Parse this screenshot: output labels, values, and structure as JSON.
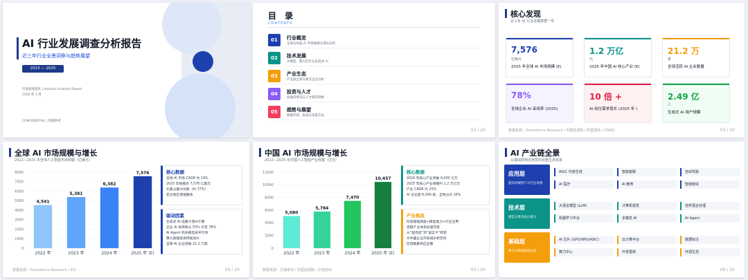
{
  "slide1": {
    "title": "AI 行业发展调查分析报告",
    "subtitle": "近三年行业全景洞察与趋势展望",
    "years": "2023 — 2025",
    "org": "行业研究团队 | Industry Analysis Report",
    "date": "2026 年 1 月",
    "confidential": "CONFIDENTIAL | 内部参考",
    "colors": {
      "accent": "#1e3a8a",
      "circle_dark": "#1e40af",
      "circle_light": "#dbe6f9"
    }
  },
  "slide2": {
    "title": "目 录",
    "title_en": "CONTENTS",
    "page": "02 / 20",
    "items": [
      {
        "num": "01",
        "label": "行业概览",
        "desc": "全球与中国 AI 市场规模与增长态势",
        "color": "#1e40af"
      },
      {
        "num": "02",
        "label": "技术发展",
        "desc": "大模型、算力芯片与生成式 AI",
        "color": "#0d9488"
      },
      {
        "num": "03",
        "label": "产业生态",
        "desc": "产业链全景与重点企业分析",
        "color": "#f59e0b"
      },
      {
        "num": "04",
        "label": "投资与人才",
        "desc": "投融资情况与人才需求洞察",
        "color": "#8b5cf6"
      },
      {
        "num": "05",
        "label": "趋势与展望",
        "desc": "政策环境、挑战与未来方向",
        "color": "#f43f5e"
      }
    ]
  },
  "slide3": {
    "title": "核心发现",
    "subtitle": "近三年 AI 行业关键数据一览",
    "source": "数据来源：Precedence Research / 中国信通院 / 阿里通信 / CNNIC",
    "page": "03 / 20",
    "cards": [
      {
        "value": "7,576",
        "unit": "亿美元",
        "desc": "2025 年全球 AI 市场规模 (E)",
        "color": "#1e40af",
        "bg": "#ffffff"
      },
      {
        "value": "1.2 万亿",
        "unit": "元",
        "desc": "2025 年中国 AI 核心产业 (E)",
        "color": "#0d9488",
        "bg": "#ffffff"
      },
      {
        "value": "21.2 万",
        "unit": "家",
        "desc": "全球活跃 AI 企业数量",
        "color": "#f59e0b",
        "bg": "#ffffff"
      },
      {
        "value": "78%",
        "unit": "",
        "desc": "全球企业 AI 采用率 (2025)",
        "color": "#8b5cf6",
        "bg": "#f5f3ff"
      },
      {
        "value": "10 倍 +",
        "unit": "",
        "desc": "AI 岗位需求增长 (2025 年 )",
        "color": "#e11d48",
        "bg": "#fff1f2"
      },
      {
        "value": "2.49 亿",
        "unit": "人",
        "desc": "生成式 AI 用户规模",
        "color": "#16a34a",
        "bg": "#f0fdf4"
      }
    ]
  },
  "slide4": {
    "title": "全球 AI 市场规模与增长",
    "subtitle": "2022—2025 年全球人工智能市场规模（亿美元）",
    "source": "数据来源：Precedence Research / IDC",
    "page": "04 / 20",
    "box1": {
      "heading": "核心数据",
      "lines": [
        "全球 AI 市场 CAGR 约 19%",
        "2025 年规模达 7,576 亿美元",
        "北美占最大份额（约 37%）",
        "亚太地区增速最快"
      ]
    },
    "box2": {
      "heading": "驱动因素",
      "lines": [
        "生成式 AI 成最大增长引擎",
        "企业 AI 采用率从 55% 升至 78%",
        "AI Agent 和多模态技术引领",
        "算力基建投资持续加大",
        "全球 AI 企业突破 21.2 万家"
      ]
    }
  },
  "slide5": {
    "title": "中国 AI 市场规模与增长",
    "subtitle": "2022—2025 年中国人工智能产业规模（亿元）",
    "source": "数据来源：艾瑞咨询 / 中国信通院 / 艾瑞咨询",
    "page": "05 / 20",
    "box1": {
      "heading": "核心数据",
      "lines": [
        "2024 年核心产业突破 9,000 亿元",
        "2025 年核心产业规模约 1.2 万亿元",
        "产业 CAGR 约 25%",
        "AI 企业超 6,000 家，全球占比 16%"
      ]
    },
    "box2": {
      "heading": "产业格局",
      "lines": [
        "形成基础底座+模型能力+行业应用",
        "百模产业体系加速完善",
        "从“能完成”到“能实干”转变",
        "为中国企业开拓城乡新空间",
        "区域集聚效应显著"
      ]
    }
  },
  "slide6": {
    "title": "AI 产业链全景",
    "subtitle": "从基础层到应用层的完整生态体系",
    "page": "06 / 20",
    "layers": [
      {
        "name": "应用层",
        "desc": "面向终端用户与行业场景",
        "color": "#1e40af",
        "cells": [
          "AIGC 内容生成",
          "智能客服",
          "自动驾驶",
          "AI 医疗",
          "AI 教育",
          "智能制造"
        ]
      },
      {
        "name": "技术层",
        "desc": "模型与算法核心能力",
        "color": "#0d9488",
        "cells": [
          "大语言模型 (LLM)",
          "计算机视觉",
          "自然语言处理",
          "机器学习平台",
          "多模态 AI",
          "AI Agent"
        ]
      },
      {
        "name": "基础层",
        "desc": "算力与数据基础设施",
        "color": "#f59e0b",
        "cells": [
          "AI 芯片 (GPU/NPU/ASIC)",
          "云计算平台",
          "数据标注",
          "算力中心",
          "开发框架",
          "开源生态"
        ]
      }
    ]
  },
  "chart_data": [
    {
      "type": "bar",
      "title": "2022—2025 年全球人工智能市场规模（亿美元）",
      "categories": [
        "2022 年",
        "2023 年",
        "2024 年",
        "2025 年 (E)"
      ],
      "values": [
        4541,
        5381,
        6382,
        7576
      ],
      "value_labels": [
        "4,541",
        "5,381",
        "6,382",
        "7,576"
      ],
      "y_ticks": [
        0,
        1000,
        2000,
        3000,
        4000,
        5000,
        6000,
        7000,
        8000
      ],
      "ylim": [
        0,
        8000
      ],
      "colors": [
        "#93c5fd",
        "#60a5fa",
        "#3b82f6",
        "#1e40af"
      ],
      "grid": true
    },
    {
      "type": "bar",
      "title": "2022—2025 年中国人工智能产业规模（亿元）",
      "categories": [
        "2022 年",
        "2023 年",
        "2024 年",
        "2025 年 (E)"
      ],
      "values": [
        5080,
        5784,
        7470,
        10457
      ],
      "value_labels": [
        "5,080",
        "5,784",
        "7,470",
        "10,457"
      ],
      "y_ticks": [
        0,
        2000,
        4000,
        6000,
        8000,
        10000,
        12000
      ],
      "ylim": [
        0,
        12000
      ],
      "colors": [
        "#5eead4",
        "#34d399",
        "#22c55e",
        "#15803d"
      ],
      "grid": true
    }
  ]
}
